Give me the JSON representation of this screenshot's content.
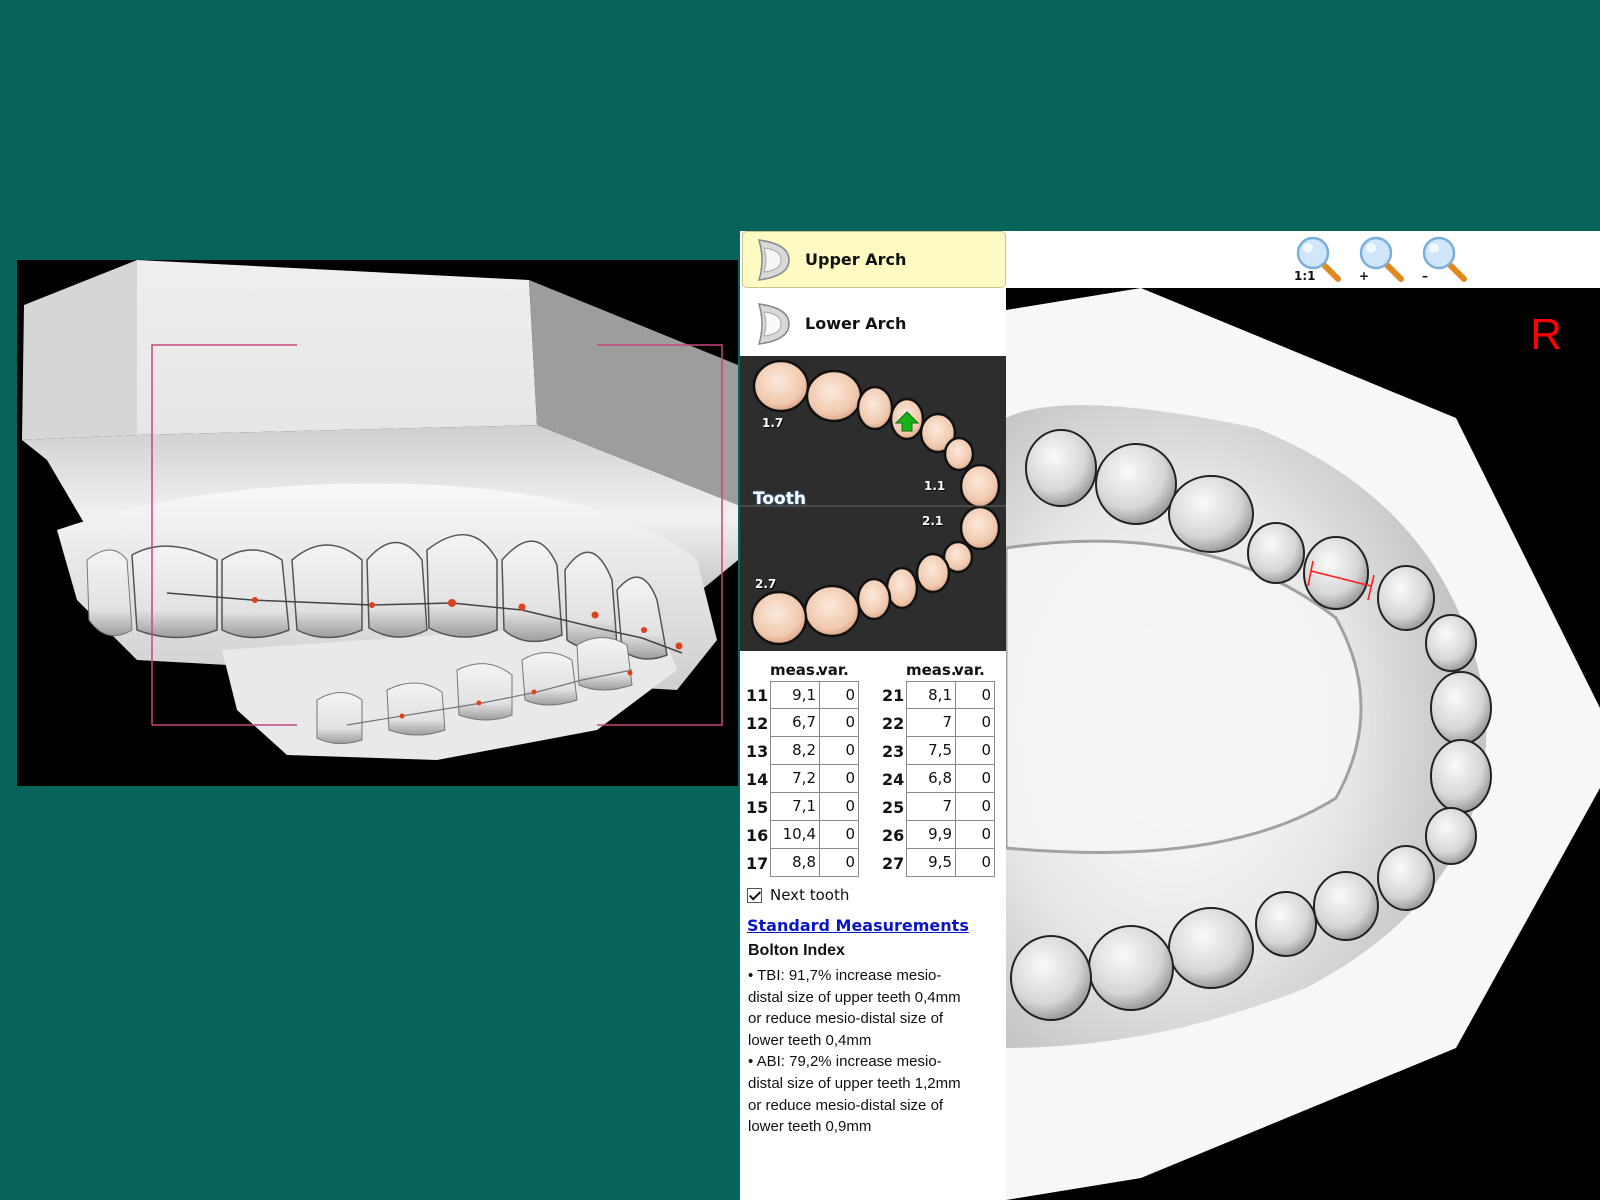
{
  "arch_selector": {
    "upper": {
      "label": "Upper Arch",
      "selected": true,
      "icon": "upper-arch-icon"
    },
    "lower": {
      "label": "Lower Arch",
      "selected": false,
      "icon": "lower-arch-icon"
    }
  },
  "tooth_chart": {
    "title": "Tooth",
    "labels": {
      "upper_molar": "1.7",
      "upper_central": "1.1",
      "lower_central": "2.1",
      "lower_molar": "2.7"
    },
    "selected_tooth_indicator": "green-up-arrow-icon"
  },
  "measurements": {
    "headers": {
      "meas": "meas.",
      "var": "var."
    },
    "quadrant1": [
      {
        "tooth": "11",
        "meas": "9,1",
        "var": "0"
      },
      {
        "tooth": "12",
        "meas": "6,7",
        "var": "0"
      },
      {
        "tooth": "13",
        "meas": "8,2",
        "var": "0"
      },
      {
        "tooth": "14",
        "meas": "7,2",
        "var": "0"
      },
      {
        "tooth": "15",
        "meas": "7,1",
        "var": "0"
      },
      {
        "tooth": "16",
        "meas": "10,4",
        "var": "0"
      },
      {
        "tooth": "17",
        "meas": "8,8",
        "var": "0"
      }
    ],
    "quadrant2": [
      {
        "tooth": "21",
        "meas": "8,1",
        "var": "0"
      },
      {
        "tooth": "22",
        "meas": "7",
        "var": "0"
      },
      {
        "tooth": "23",
        "meas": "7,5",
        "var": "0"
      },
      {
        "tooth": "24",
        "meas": "6,8",
        "var": "0"
      },
      {
        "tooth": "25",
        "meas": "7",
        "var": "0"
      },
      {
        "tooth": "26",
        "meas": "9,9",
        "var": "0"
      },
      {
        "tooth": "27",
        "meas": "9,5",
        "var": "0"
      }
    ]
  },
  "next_tooth": {
    "label": "Next tooth",
    "checked": true
  },
  "standard_measurements_link": "Standard Measurements",
  "bolton": {
    "title": "Bolton Index",
    "lines": [
      "• TBI: 91,7% increase mesio-",
      "distal size of upper teeth 0,4mm",
      "or reduce mesio-distal size of",
      "lower teeth 0,4mm",
      "• ABI: 79,2% increase mesio-",
      "distal size of upper teeth 1,2mm",
      "or reduce mesio-distal size of",
      "lower teeth 0,9mm"
    ]
  },
  "toolbar": {
    "zoom_fit_label": "1:1",
    "zoom_in_label": "+",
    "zoom_out_label": "–"
  },
  "occlusal_view": {
    "side_marker": "R"
  },
  "colors": {
    "background": "#07645a",
    "selected_arch_bg": "#fdfbc2",
    "link": "#0a15c8",
    "side_marker": "#ff0000",
    "landmark_point": "#e0401a",
    "measurement_line": "#ff1a1a"
  }
}
